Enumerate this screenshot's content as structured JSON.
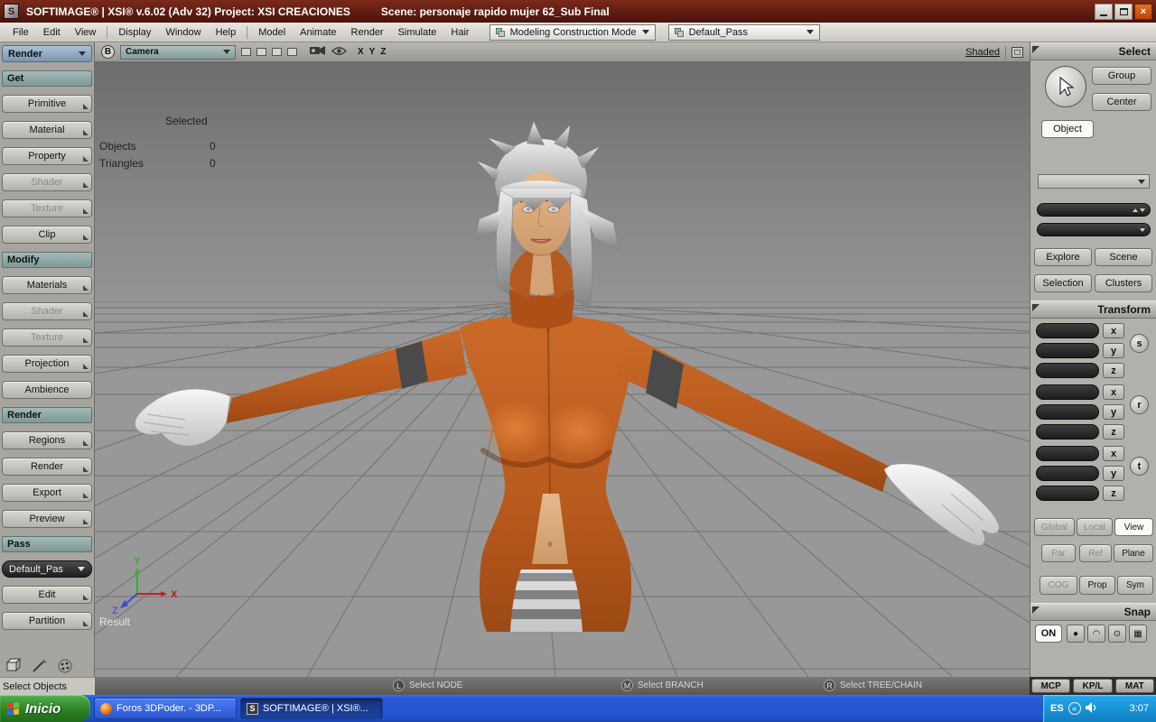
{
  "titlebar": {
    "title": "SOFTIMAGE® | XSI® v.6.02 (Adv 32) Project: XSI CREACIONES",
    "scene": "Scene: personaje rapido mujer 62_Sub Final"
  },
  "icons": {
    "close_glyph": "×",
    "xsi_logo": "S",
    "tray_collapse": "«",
    "speaker": "♪",
    "snap_glyphs": [
      "●",
      "◠",
      "⊙",
      "▦"
    ]
  },
  "menubar": {
    "menus": [
      "File",
      "Edit",
      "View",
      "Display",
      "Window",
      "Help",
      "Model",
      "Animate",
      "Render",
      "Simulate",
      "Hair"
    ],
    "construction_mode": "Modeling Construction Mode",
    "pass_selector": "Default_Pass"
  },
  "left_panel": {
    "mode": "Render",
    "sections": {
      "get": "Get",
      "modify": "Modify",
      "render": "Render",
      "pass": "Pass"
    },
    "get_buttons": [
      "Primitive",
      "Material",
      "Property",
      "Shader",
      "Texture",
      "Clip"
    ],
    "modify_buttons": [
      "Materials",
      "Shader",
      "Texture",
      "Projection",
      "Ambience"
    ],
    "render_buttons": [
      "Regions",
      "Render",
      "Export",
      "Preview"
    ],
    "pass_dropdown": "Default_Pas",
    "pass_buttons": [
      "Edit",
      "Partition"
    ],
    "status": "Select Objects"
  },
  "viewport": {
    "view_letter": "B",
    "camera": "Camera",
    "axis_x": "X",
    "axis_y": "Y",
    "axis_z": "Z",
    "display_mode": "Shaded",
    "selected_label": "Selected",
    "objects_label": "Objects",
    "objects_value": "0",
    "triangles_label": "Triangles",
    "triangles_value": "0",
    "result_label": "Result"
  },
  "statusbar": {
    "l_key": "L",
    "l_label": "Select NODE",
    "m_key": "M",
    "m_label": "Select BRANCH",
    "r_key": "R",
    "r_label": "Select TREE/CHAIN"
  },
  "right_panel": {
    "select_header": "Select",
    "group_btn": "Group",
    "center_btn": "Center",
    "object_btn": "Object",
    "explore_btn": "Explore",
    "scene_btn": "Scene",
    "selection_btn": "Selection",
    "clusters_btn": "Clusters",
    "transform_header": "Transform",
    "axes": [
      "x",
      "y",
      "z"
    ],
    "scale_key": "s",
    "rotate_key": "r",
    "translate_key": "t",
    "global_btn": "Global",
    "local_btn": "Local",
    "view_btn": "View",
    "par_btn": "Par",
    "ref_btn": "Ref",
    "plane_btn": "Plane",
    "cog_btn": "COG",
    "prop_btn": "Prop",
    "sym_btn": "Sym",
    "snap_header": "Snap",
    "snap_on": "ON",
    "mcp_btn": "MCP",
    "kpl_btn": "KP/L",
    "mat_btn": "MAT"
  },
  "taskbar": {
    "start": "Inicio",
    "task1": "Foros 3DPoder. - 3DP...",
    "task2": "SOFTIMAGE® | XSI®...",
    "lang": "ES",
    "clock": "3:07"
  }
}
